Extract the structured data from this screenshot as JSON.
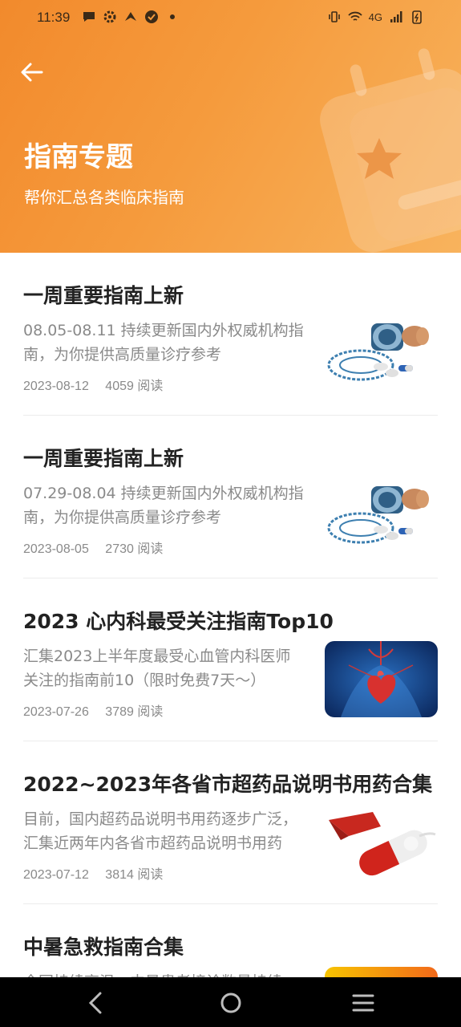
{
  "status_bar": {
    "time": "11:39",
    "network": "4G",
    "icons_left": [
      "chat-icon",
      "gear-icon",
      "bird-icon",
      "check-circle-icon",
      "dot-icon"
    ],
    "icons_right": [
      "vibrate-icon",
      "wifi-icon",
      "signal-icon",
      "battery-icon"
    ]
  },
  "header": {
    "title": "指南专题",
    "subtitle": "帮你汇总各类临床指南",
    "back_icon": "arrow-left-icon",
    "gradient_start": "#f28a2c",
    "gradient_end": "#f8b35d"
  },
  "items": [
    {
      "title": "一周重要指南上新",
      "desc": "08.05-08.11 持续更新国内外权威机构指南，为你提供高质量诊疗参考",
      "date": "2023-08-12",
      "reads": "4059 阅读",
      "thumb": "stamp-and-pills"
    },
    {
      "title": "一周重要指南上新",
      "desc": "07.29-08.04 持续更新国内外权威机构指南，为你提供高质量诊疗参考",
      "date": "2023-08-05",
      "reads": "2730 阅读",
      "thumb": "stamp-and-pills"
    },
    {
      "title": "2023 心内科最受关注指南Top10",
      "desc": "汇集2023上半年度最受心血管内科医师关注的指南前10（限时免费7天～）",
      "date": "2023-07-26",
      "reads": "3789 阅读",
      "thumb": "heart-anatomy"
    },
    {
      "title": "2022~2023年各省市超药品说明书用药合集",
      "desc": "目前，国内超药品说明书用药逐步广泛，汇集近两年内各省市超药品说明书用药",
      "date": "2023-07-12",
      "reads": "3814 阅读",
      "thumb": "flying-capsule"
    },
    {
      "title": "中暑急救指南合集",
      "desc": "全国持续高温，中暑患者接诊数量持续",
      "date": "",
      "reads": "",
      "thumb": "sun-heat"
    }
  ],
  "nav": {
    "back": "nav-back-icon",
    "home": "nav-home-icon",
    "menu": "nav-menu-icon"
  }
}
